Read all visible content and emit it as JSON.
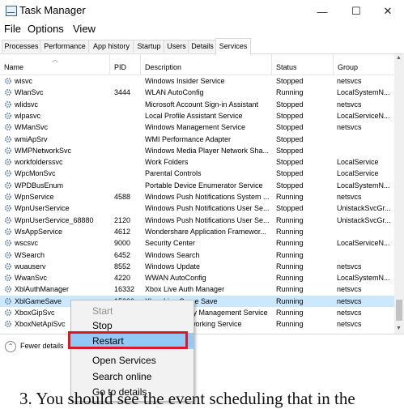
{
  "window": {
    "title": "Task Manager",
    "controls": {
      "minimize": "—",
      "maximize": "☐",
      "close": "✕"
    }
  },
  "menu": [
    "File",
    "Options",
    "View"
  ],
  "tabs": [
    "Processes",
    "Performance",
    "App history",
    "Startup",
    "Users",
    "Details",
    "Services"
  ],
  "active_tab": "Services",
  "columns": [
    "Name",
    "PID",
    "Description",
    "Status",
    "Group"
  ],
  "rows": [
    {
      "name": "wisvc",
      "pid": "",
      "desc": "Windows Insider Service",
      "status": "Stopped",
      "group": "netsvcs"
    },
    {
      "name": "WlanSvc",
      "pid": "3444",
      "desc": "WLAN AutoConfig",
      "status": "Running",
      "group": "LocalSystemN..."
    },
    {
      "name": "wlidsvc",
      "pid": "",
      "desc": "Microsoft Account Sign-in Assistant",
      "status": "Stopped",
      "group": "netsvcs"
    },
    {
      "name": "wlpasvc",
      "pid": "",
      "desc": "Local Profile Assistant Service",
      "status": "Stopped",
      "group": "LocalServiceN..."
    },
    {
      "name": "WManSvc",
      "pid": "",
      "desc": "Windows Management Service",
      "status": "Stopped",
      "group": "netsvcs"
    },
    {
      "name": "wmiApSrv",
      "pid": "",
      "desc": "WMI Performance Adapter",
      "status": "Stopped",
      "group": ""
    },
    {
      "name": "WMPNetworkSvc",
      "pid": "",
      "desc": "Windows Media Player Network Sha...",
      "status": "Stopped",
      "group": ""
    },
    {
      "name": "workfolderssvc",
      "pid": "",
      "desc": "Work Folders",
      "status": "Stopped",
      "group": "LocalService"
    },
    {
      "name": "WpcMonSvc",
      "pid": "",
      "desc": "Parental Controls",
      "status": "Stopped",
      "group": "LocalService"
    },
    {
      "name": "WPDBusEnum",
      "pid": "",
      "desc": "Portable Device Enumerator Service",
      "status": "Stopped",
      "group": "LocalSystemN..."
    },
    {
      "name": "WpnService",
      "pid": "4588",
      "desc": "Windows Push Notifications System ...",
      "status": "Running",
      "group": "netsvcs"
    },
    {
      "name": "WpnUserService",
      "pid": "",
      "desc": "Windows Push Notifications User Se...",
      "status": "Stopped",
      "group": "UnistackSvcGr..."
    },
    {
      "name": "WpnUserService_68880",
      "pid": "2120",
      "desc": "Windows Push Notifications User Se...",
      "status": "Running",
      "group": "UnistackSvcGr..."
    },
    {
      "name": "WsAppService",
      "pid": "4612",
      "desc": "Wondershare Application Framewor...",
      "status": "Running",
      "group": ""
    },
    {
      "name": "wscsvc",
      "pid": "9000",
      "desc": "Security Center",
      "status": "Running",
      "group": "LocalServiceN..."
    },
    {
      "name": "WSearch",
      "pid": "6452",
      "desc": "Windows Search",
      "status": "Running",
      "group": ""
    },
    {
      "name": "wuauserv",
      "pid": "8552",
      "desc": "Windows Update",
      "status": "Running",
      "group": "netsvcs"
    },
    {
      "name": "WwanSvc",
      "pid": "4220",
      "desc": "WWAN AutoConfig",
      "status": "Running",
      "group": "LocalSystemN..."
    },
    {
      "name": "XblAuthManager",
      "pid": "16332",
      "desc": "Xbox Live Auth Manager",
      "status": "Running",
      "group": "netsvcs"
    },
    {
      "name": "XblGameSave",
      "pid": "15000",
      "desc": "Xbox Live Game Save",
      "status": "Running",
      "group": "netsvcs"
    },
    {
      "name": "XboxGipSvc",
      "pid": "",
      "desc": "Xbox Accessory Management Service",
      "status": "Running",
      "group": "netsvcs"
    },
    {
      "name": "XboxNetApiSvc",
      "pid": "",
      "desc": "Xbox Live Networking Service",
      "status": "Running",
      "group": "netsvcs"
    }
  ],
  "selected_row": "XblGameSave",
  "footer": {
    "fewer_details": "Fewer details"
  },
  "context_menu": [
    "Start",
    "Stop",
    "Restart",
    "Open Services",
    "Search online",
    "Go to details"
  ],
  "caption": "3. You should see the event scheduling that in the",
  "colors": {
    "selection": "#cce8ff",
    "menu_highlight": "#91c9f7",
    "annotation_box": "#d9182a"
  }
}
